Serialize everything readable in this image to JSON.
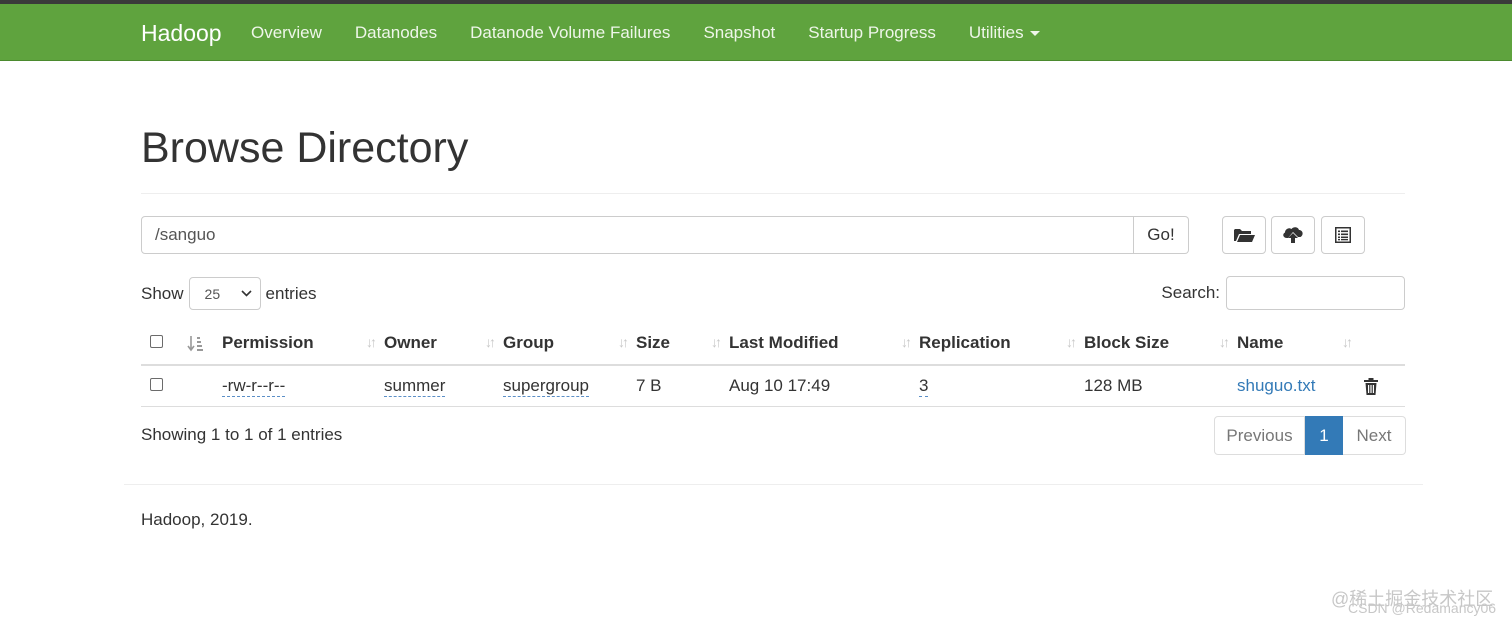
{
  "navbar": {
    "brand": "Hadoop",
    "items": [
      "Overview",
      "Datanodes",
      "Datanode Volume Failures",
      "Snapshot",
      "Startup Progress",
      "Utilities"
    ],
    "bg_color": "#5fa33e"
  },
  "page": {
    "title": "Browse Directory"
  },
  "path": {
    "value": "/sanguo",
    "go_label": "Go!"
  },
  "toolbar_icons": [
    "folder-open-icon",
    "cloud-upload-icon",
    "list-alt-icon"
  ],
  "length": {
    "show_label": "Show",
    "value": "25",
    "entries_label": "entries"
  },
  "search": {
    "label": "Search:",
    "value": ""
  },
  "table": {
    "headers": [
      "Permission",
      "Owner",
      "Group",
      "Size",
      "Last Modified",
      "Replication",
      "Block Size",
      "Name"
    ],
    "rows": [
      {
        "permission": "-rw-r--r--",
        "owner": "summer",
        "group": "supergroup",
        "size": "7 B",
        "last_modified": "Aug 10 17:49",
        "replication": "3",
        "block_size": "128 MB",
        "name": "shuguo.txt"
      }
    ]
  },
  "info": "Showing 1 to 1 of 1 entries",
  "pagination": {
    "previous": "Previous",
    "current": "1",
    "next": "Next"
  },
  "footer": "Hadoop, 2019.",
  "watermark": {
    "line1": "@稀土掘金技术社区",
    "line2": "CSDN @Redamancy06"
  },
  "colors": {
    "link": "#337ab7",
    "active_page": "#337ab7"
  }
}
